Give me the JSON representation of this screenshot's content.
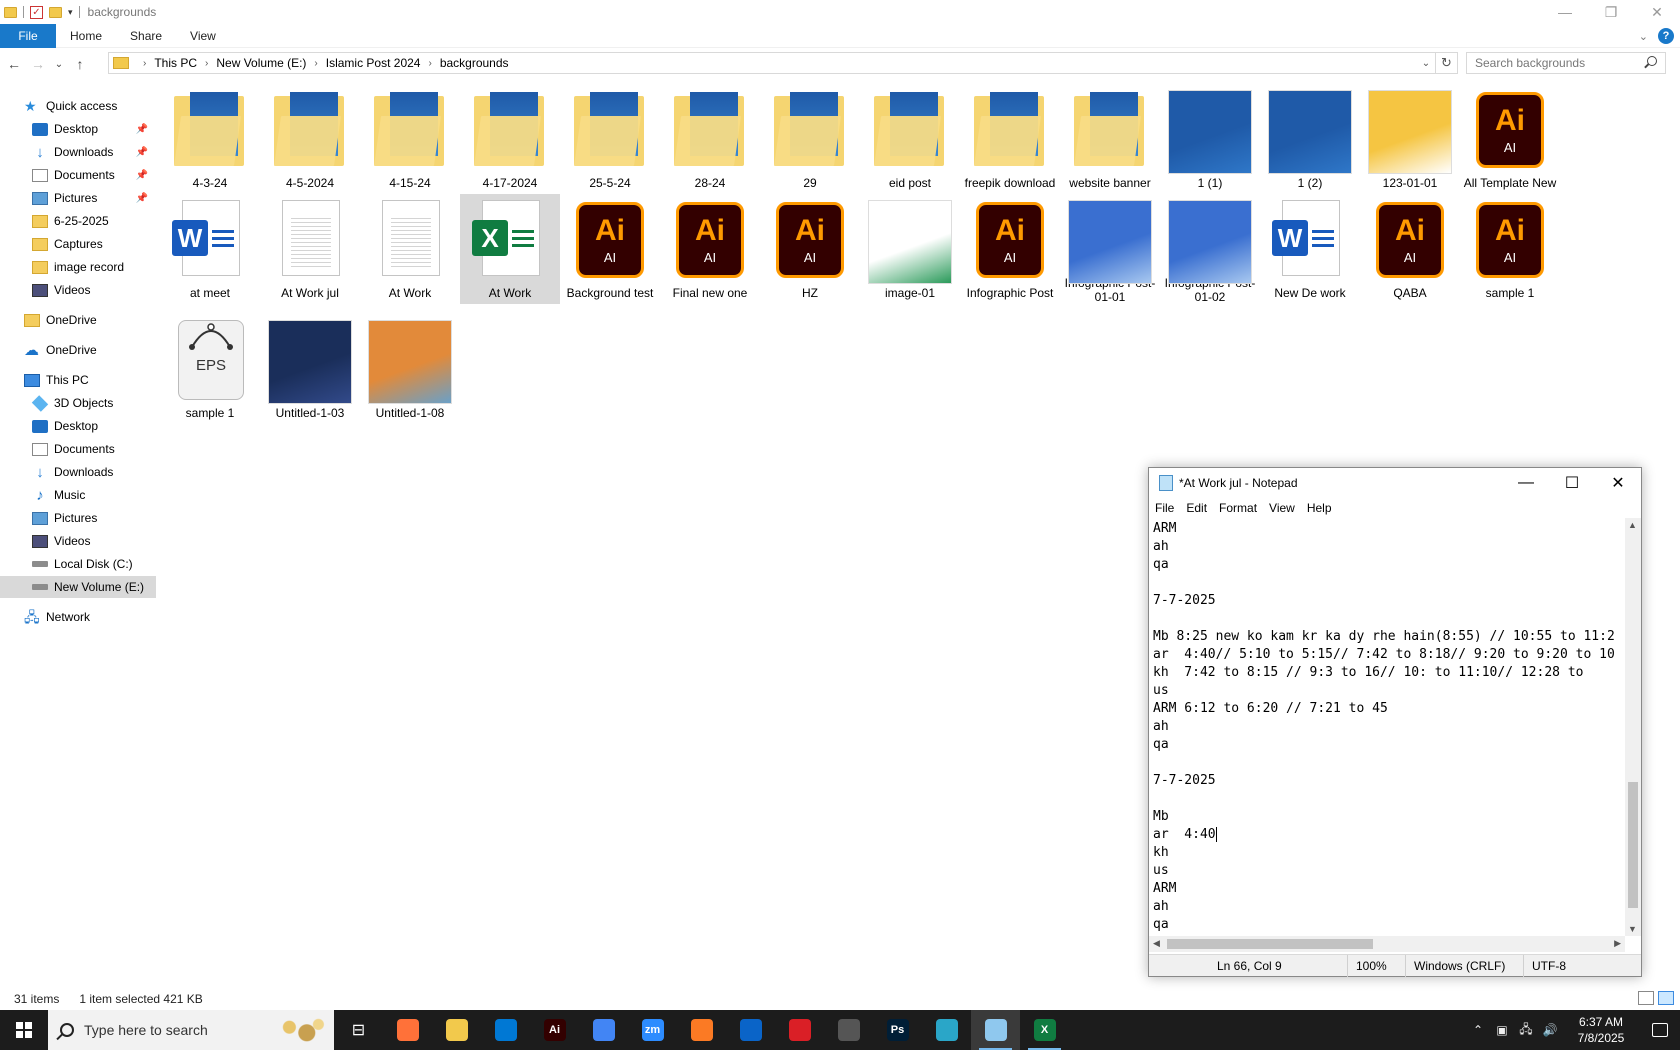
{
  "explorer": {
    "title": "backgrounds",
    "ribbon_tabs": [
      "File",
      "Home",
      "Share",
      "View"
    ],
    "breadcrumb": [
      "This PC",
      "New Volume (E:)",
      "Islamic Post 2024",
      "backgrounds"
    ],
    "search_placeholder": "Search backgrounds",
    "help_label": "?",
    "sidebar": {
      "quick_access": "Quick access",
      "quick_items": [
        "Desktop",
        "Downloads",
        "Documents",
        "Pictures",
        "6-25-2025",
        "Captures",
        "image record",
        "Videos"
      ],
      "onedrive_1": "OneDrive",
      "onedrive_2": "OneDrive",
      "this_pc": "This PC",
      "pc_items": [
        "3D Objects",
        "Desktop",
        "Documents",
        "Downloads",
        "Music",
        "Pictures",
        "Videos",
        "Local Disk (C:)",
        "New Volume (E:)"
      ],
      "network": "Network"
    },
    "files": [
      {
        "name": "4-3-24",
        "type": "folder"
      },
      {
        "name": "4-5-2024",
        "type": "folder"
      },
      {
        "name": "4-15-24",
        "type": "folder"
      },
      {
        "name": "4-17-2024",
        "type": "folder"
      },
      {
        "name": "25-5-24",
        "type": "folder"
      },
      {
        "name": "28-24",
        "type": "folder"
      },
      {
        "name": "29",
        "type": "folder"
      },
      {
        "name": "eid post",
        "type": "folder"
      },
      {
        "name": "freepik download",
        "type": "folder"
      },
      {
        "name": "website banner",
        "type": "folder"
      },
      {
        "name": "1 (1)",
        "type": "image"
      },
      {
        "name": "1 (2)",
        "type": "image"
      },
      {
        "name": "123-01-01",
        "type": "image"
      },
      {
        "name": "All Template New",
        "type": "ai"
      },
      {
        "name": "at meet",
        "type": "word"
      },
      {
        "name": "At Work jul",
        "type": "text"
      },
      {
        "name": "At Work",
        "type": "text"
      },
      {
        "name": "At Work",
        "type": "excel",
        "selected": true
      },
      {
        "name": "Background test",
        "type": "ai"
      },
      {
        "name": "Final new one",
        "type": "ai"
      },
      {
        "name": "HZ",
        "type": "ai"
      },
      {
        "name": "image-01",
        "type": "image"
      },
      {
        "name": "Infographic Post",
        "type": "ai"
      },
      {
        "name": "Infographic Post-01-01",
        "type": "image"
      },
      {
        "name": "Infographic Post-01-02",
        "type": "image"
      },
      {
        "name": "New De work",
        "type": "word"
      },
      {
        "name": "QABA",
        "type": "ai"
      },
      {
        "name": "sample 1",
        "type": "ai"
      },
      {
        "name": "sample 1",
        "type": "eps"
      },
      {
        "name": "Untitled-1-03",
        "type": "image"
      },
      {
        "name": "Untitled-1-08",
        "type": "image"
      }
    ],
    "status_count": "31 items",
    "status_selection": "1 item selected  421 KB"
  },
  "notepad": {
    "title": "*At Work jul - Notepad",
    "menu": [
      "File",
      "Edit",
      "Format",
      "View",
      "Help"
    ],
    "lines": [
      "ARM",
      "ah",
      "qa",
      "",
      "7-7-2025",
      "",
      "Mb 8:25 new ko kam kr ka dy rhe hain(8:55) // 10:55 to 11:2",
      "ar  4:40// 5:10 to 5:15// 7:42 to 8:18// 9:20 to 9:20 to 10",
      "kh  7:42 to 8:15 // 9:3 to 16// 10: to 11:10// 12:28 to",
      "us",
      "ARM 6:12 to 6:20 // 7:21 to 45",
      "ah",
      "qa",
      "",
      "7-7-2025",
      "",
      "Mb",
      "ar  4:40",
      "kh",
      "us",
      "ARM",
      "ah",
      "qa"
    ],
    "status_pos": "Ln 66, Col 9",
    "status_zoom": "100%",
    "status_eol": "Windows (CRLF)",
    "status_enc": "UTF-8"
  },
  "taskbar": {
    "search_placeholder": "Type here to search",
    "apps": [
      {
        "name": "firefox-icon",
        "color": "#ff7139",
        "label": ""
      },
      {
        "name": "file-explorer-icon",
        "color": "#f2c94c",
        "label": ""
      },
      {
        "name": "vscode-icon",
        "color": "#0078d4",
        "label": ""
      },
      {
        "name": "illustrator-icon",
        "color": "#330000",
        "label": "Ai"
      },
      {
        "name": "chrome-icon",
        "color": "#4285f4",
        "label": ""
      },
      {
        "name": "zoom-icon",
        "color": "#2d8cff",
        "label": "zm"
      },
      {
        "name": "xampp-icon",
        "color": "#fb7a24",
        "label": ""
      },
      {
        "name": "outlook-icon",
        "color": "#0a64c8",
        "label": ""
      },
      {
        "name": "creative-cloud-icon",
        "color": "#da1f26",
        "label": ""
      },
      {
        "name": "pen-tool-icon",
        "color": "#555555",
        "label": ""
      },
      {
        "name": "photoshop-icon",
        "color": "#001e36",
        "label": "Ps"
      },
      {
        "name": "app-icon",
        "color": "#2aa6c8",
        "label": ""
      },
      {
        "name": "notepad-icon",
        "color": "#8fc8ee",
        "label": ""
      },
      {
        "name": "excel-icon",
        "color": "#107c41",
        "label": "X"
      }
    ],
    "time": "6:37 AM",
    "date": "7/8/2025"
  }
}
